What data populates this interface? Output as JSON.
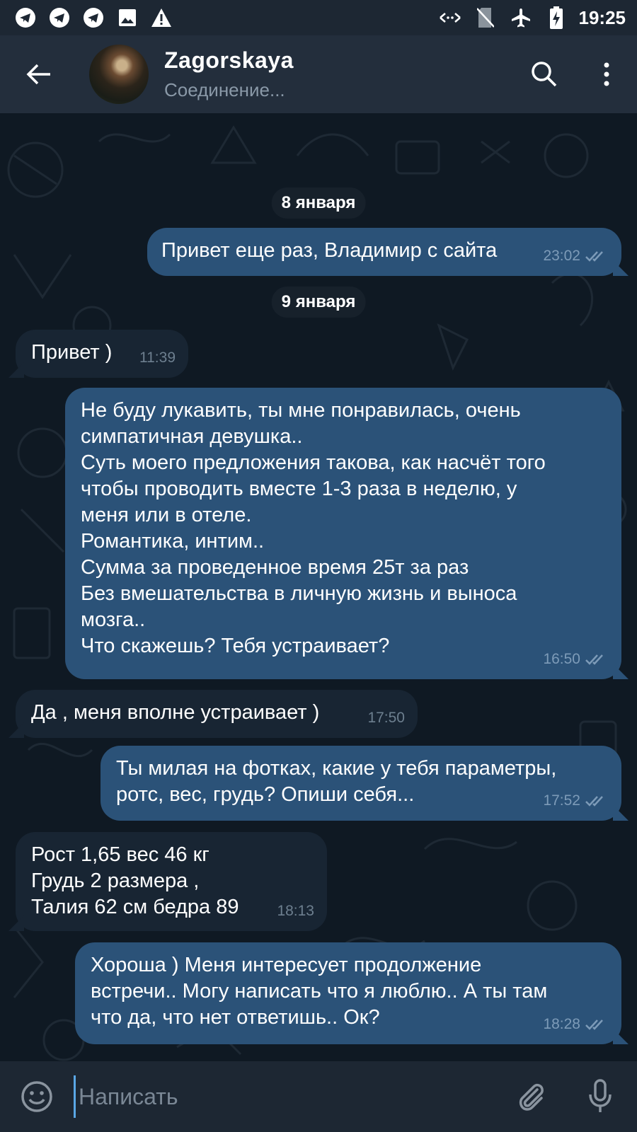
{
  "status_bar": {
    "time": "19:25",
    "left_icons": [
      "telegram-icon",
      "telegram-icon",
      "telegram-icon",
      "image-icon",
      "warning-icon"
    ],
    "right_icons": [
      "data-arrows-icon",
      "no-sim-icon",
      "airplane-icon",
      "battery-charging-icon"
    ]
  },
  "header": {
    "title": "Zagorskaya",
    "status": "Соединение..."
  },
  "messages": [
    {
      "type": "date",
      "text": "8 января"
    },
    {
      "type": "out",
      "text": "Привет еще раз, Владимир с сайта",
      "time": "23:02"
    },
    {
      "type": "date",
      "text": "9 января"
    },
    {
      "type": "in",
      "text": "Привет )",
      "time": "11:39"
    },
    {
      "type": "out",
      "text": "Не буду лукавить, ты мне понравилась, очень\nсимпатичная девушка..\nСуть моего предложения такова, как насчёт того\nчтобы проводить вместе 1-3 раза в неделю, у\nменя или в отеле.\nРомантика, интим..\nСумма за проведенное время 25т за раз\nБез вмешательства в личную жизнь и выноса\nмозга..\nЧто скажешь? Тебя устраивает?",
      "time": "16:50"
    },
    {
      "type": "in",
      "text": "Да , меня вполне устраивает )",
      "time": "17:50"
    },
    {
      "type": "out",
      "text": "Ты милая на фотках, какие у тебя параметры,\nротс, вес, грудь? Опиши себя...",
      "time": "17:52"
    },
    {
      "type": "in",
      "text": "Рост 1,65 вес 46 кг\nГрудь 2 размера ,\nТалия 62 см бедра 89",
      "time": "18:13"
    },
    {
      "type": "out",
      "text": "Хороша ) Меня интересует продолжение\nвстречи.. Могу написать что я люблю.. А ты там\nчто да, что нет ответишь.. Ок?",
      "time": "18:28"
    }
  ],
  "input": {
    "placeholder": "Написать"
  },
  "colors": {
    "header_bg": "#232e3c",
    "chat_bg": "#0f1923",
    "bubble_out": "#2b5278",
    "bubble_in": "#182533",
    "read_check": "#7d9bb8",
    "accent": "#5aa7e6"
  }
}
